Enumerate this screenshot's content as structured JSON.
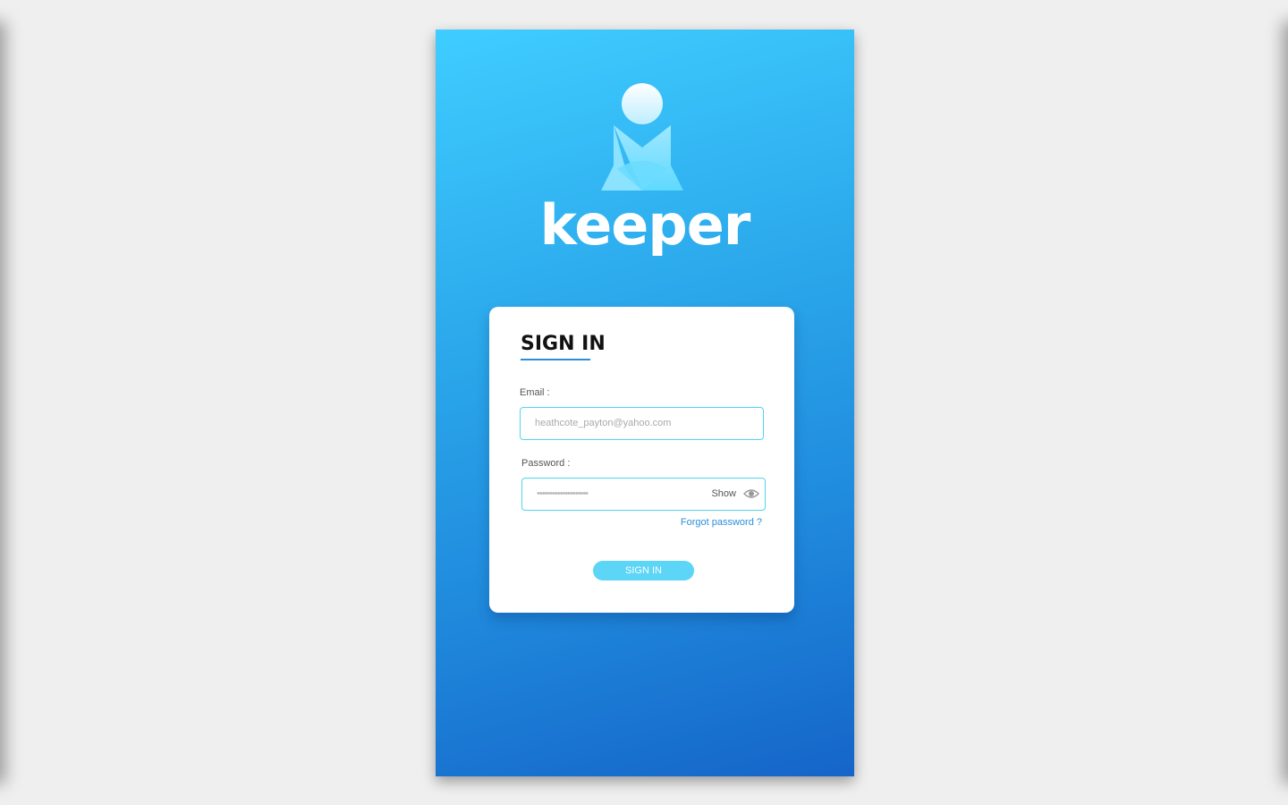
{
  "brand": {
    "name": "keeper",
    "logo_icon": "person-x-logo-icon"
  },
  "form": {
    "title": "SIGN IN",
    "email_label": "Email :",
    "email_placeholder": "heathcote_payton@yahoo.com",
    "password_label": "Password :",
    "password_value": "••••••••••••••••••••",
    "show_label": "Show",
    "show_icon": "eye-icon",
    "forgot_label": "Forgot password ?",
    "submit_label": "SIGN IN"
  },
  "colors": {
    "gradient_top": "#3fcdff",
    "gradient_bottom": "#1565c8",
    "accent": "#2a8fd8",
    "field_border": "#4fd6f0",
    "button": "#5cd5f7"
  }
}
